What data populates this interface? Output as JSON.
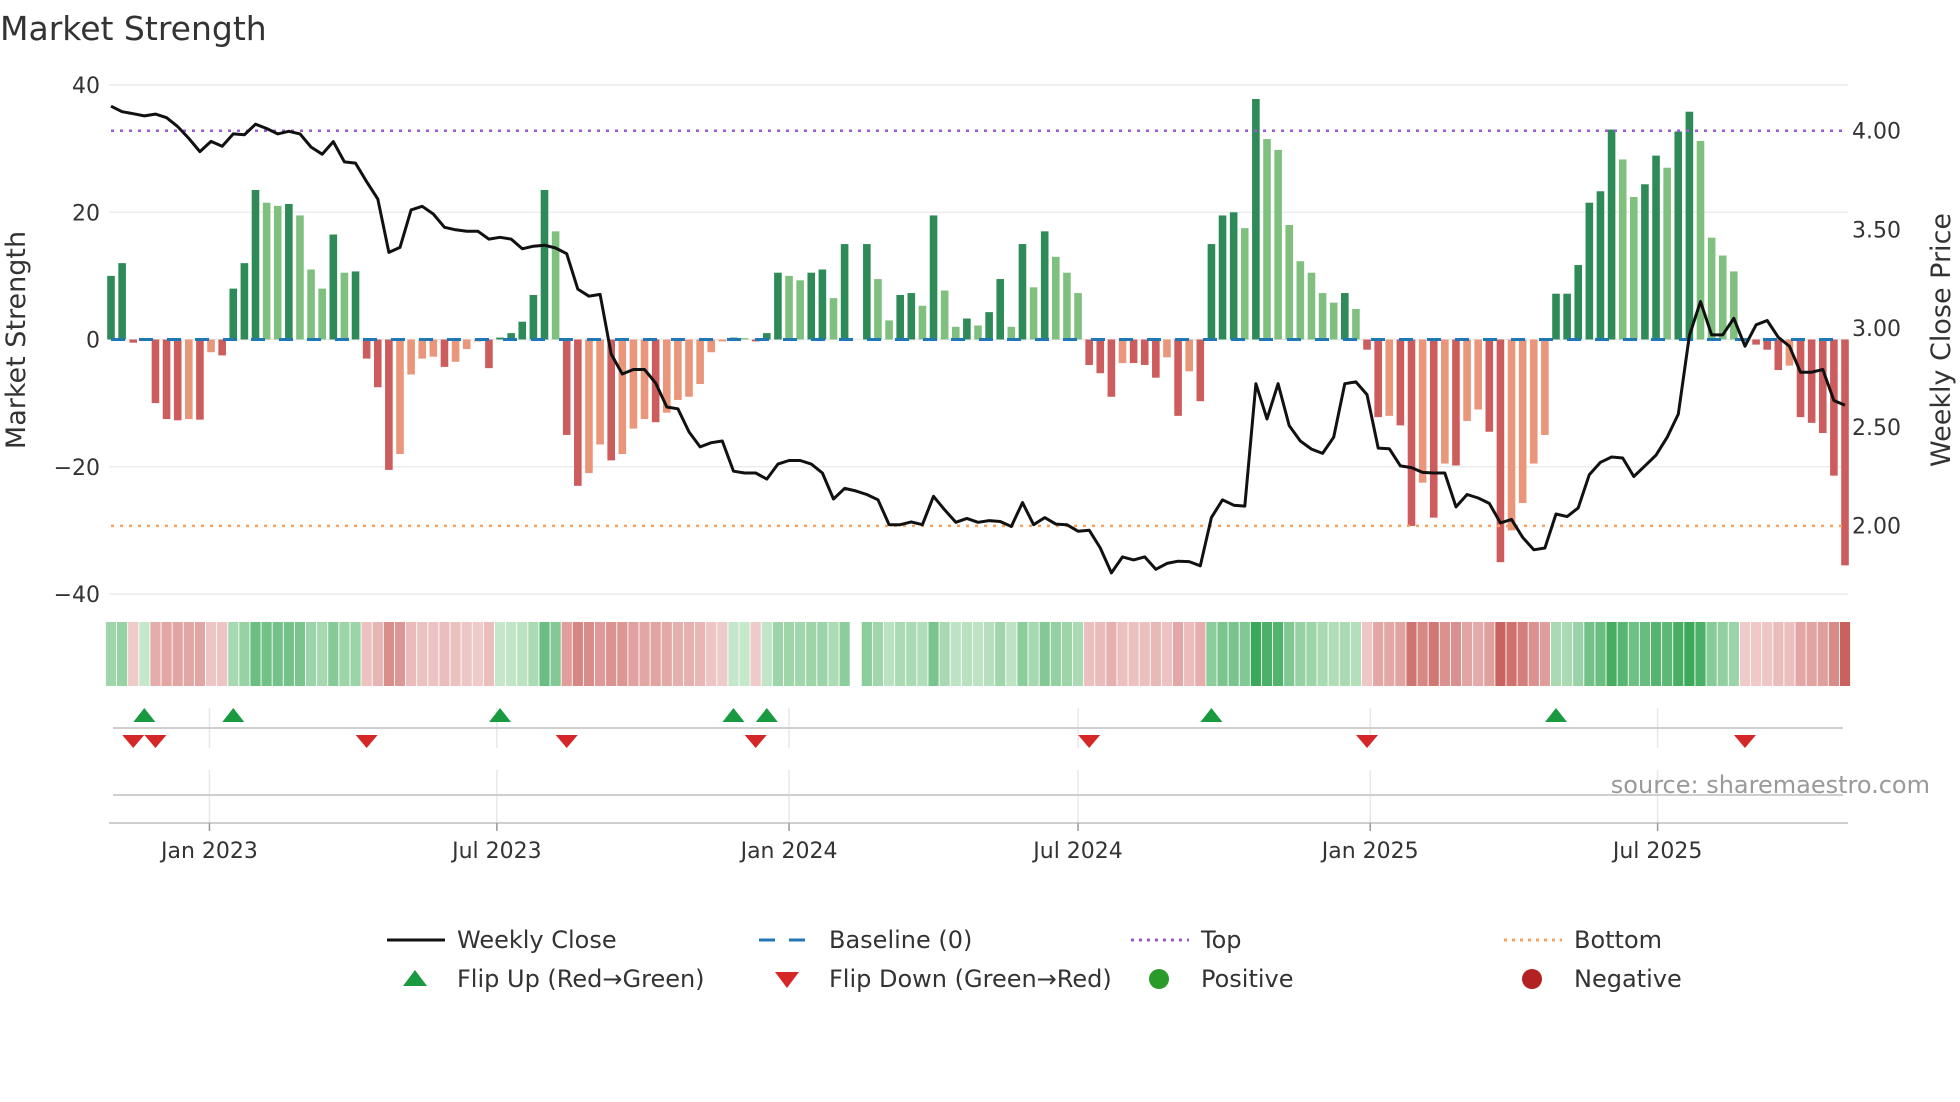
{
  "chart_data": {
    "type": "bar",
    "title": "Market Strength",
    "ylabel": "Market Strength",
    "y2label": "Weekly Close Price",
    "ylim": [
      -40,
      40
    ],
    "y2lim": [
      1.944,
      4.272
    ],
    "yticks": [
      "40",
      "20",
      "0",
      "−20",
      "−40"
    ],
    "ytick_values": [
      40,
      20,
      0,
      -20,
      -40
    ],
    "y2ticks": [
      "4.00",
      "3.50",
      "3.00",
      "2.50",
      "2.00"
    ],
    "y2tick_values": [
      4.0,
      3.5,
      3.0,
      2.5,
      2.0
    ],
    "start_date": "2022-10-31",
    "frequency": "weekly",
    "xticks": [
      {
        "label": "Jan 2023",
        "date": "2023-01-01"
      },
      {
        "label": "Jul 2023",
        "date": "2023-07-01"
      },
      {
        "label": "Jan 2024",
        "date": "2024-01-01"
      },
      {
        "label": "Jul 2024",
        "date": "2024-07-01"
      },
      {
        "label": "Jan 2025",
        "date": "2025-01-01"
      },
      {
        "label": "Jul 2025",
        "date": "2025-07-01"
      }
    ],
    "top_threshold": 32.8,
    "bottom_threshold": -29.3,
    "baseline": 0,
    "strength": [
      10,
      12,
      -0.5,
      0.2,
      -10,
      -12.5,
      -12.7,
      -12.5,
      -12.6,
      -2,
      -2.5,
      8,
      12,
      23.5,
      21.5,
      21,
      21.3,
      19.5,
      11,
      8,
      16.5,
      10.5,
      10.7,
      -3,
      -7.5,
      -20.5,
      -18,
      -5.5,
      -3,
      -2.7,
      -4.3,
      -3.5,
      -1.5,
      -0.3,
      -4.5,
      0.3,
      1,
      2.8,
      7,
      23.5,
      17,
      -15,
      -23,
      -21,
      -16.5,
      -19,
      -18,
      -14,
      -12.5,
      -13,
      -11.5,
      -9.5,
      -9,
      -7,
      -2,
      -0.3,
      0.3,
      0.2,
      -0.3,
      1,
      10.5,
      10,
      9.3,
      10.5,
      11,
      6.5,
      15,
      null,
      15,
      9.5,
      3,
      7,
      7.3,
      5.3,
      19.5,
      7.7,
      2,
      3.3,
      2.2,
      4.3,
      9.5,
      2,
      15,
      8.2,
      17,
      13,
      10.5,
      7.3,
      -4,
      -5.3,
      -9,
      -3.7,
      -3.7,
      -4,
      -6,
      -2.8,
      -12,
      -5,
      -9.7,
      15,
      19.5,
      20,
      17.5,
      37.8,
      31.5,
      29.8,
      18,
      12.3,
      10.5,
      7.3,
      5.8,
      7.3,
      4.8,
      -1.6,
      -12.2,
      -12,
      -13.5,
      -29.3,
      -22.5,
      -28,
      -19.5,
      -19.8,
      -12.8,
      -11,
      -14.5,
      -35,
      -30,
      -25.7,
      -19.5,
      -15,
      7.2,
      7.2,
      11.7,
      21.5,
      23.3,
      33,
      28.3,
      22.4,
      24.4,
      28.9,
      27,
      32.7,
      35.8,
      31.2,
      16,
      13.2,
      10.7,
      -0.3,
      -0.8,
      -1.6,
      -4.8,
      -4.1,
      -12.2,
      -13.1,
      -14.7,
      -21.4,
      -35.5
    ],
    "weekly_close": [
      4.123,
      4.095,
      4.085,
      4.074,
      4.083,
      4.065,
      4.02,
      3.96,
      3.893,
      3.945,
      3.92,
      3.983,
      3.978,
      4.032,
      4.01,
      3.983,
      3.996,
      3.983,
      3.916,
      3.88,
      3.944,
      3.841,
      3.835,
      3.74,
      3.653,
      3.383,
      3.408,
      3.598,
      3.616,
      3.577,
      3.51,
      3.497,
      3.49,
      3.49,
      3.45,
      3.459,
      3.45,
      3.401,
      3.414,
      3.419,
      3.405,
      3.376,
      3.197,
      3.161,
      3.17,
      2.868,
      2.767,
      2.79,
      2.79,
      2.721,
      2.6,
      2.591,
      2.474,
      2.398,
      2.419,
      2.428,
      2.275,
      2.266,
      2.266,
      2.235,
      2.311,
      2.329,
      2.329,
      2.311,
      2.266,
      2.134,
      2.188,
      2.175,
      2.157,
      2.13,
      2.004,
      2.004,
      2.018,
      2.004,
      2.148,
      2.079,
      2.016,
      2.036,
      2.016,
      2.025,
      2.02,
      1.995,
      2.116,
      2.004,
      2.04,
      2.007,
      2.004,
      1.971,
      1.976,
      1.886,
      1.76,
      1.841,
      1.826,
      1.841,
      1.778,
      1.808,
      1.819,
      1.817,
      1.796,
      2.04,
      2.13,
      2.103,
      2.098,
      2.718,
      2.54,
      2.718,
      2.506,
      2.428,
      2.387,
      2.365,
      2.447,
      2.718,
      2.727,
      2.663,
      2.392,
      2.389,
      2.302,
      2.293,
      2.269,
      2.266,
      2.266,
      2.094,
      2.157,
      2.139,
      2.112,
      2.013,
      2.031,
      1.94,
      1.877,
      1.886,
      2.058,
      2.045,
      2.089,
      2.257,
      2.32,
      2.347,
      2.342,
      2.248,
      2.302,
      2.356,
      2.447,
      2.564,
      2.962,
      3.134,
      2.965,
      2.965,
      3.049,
      2.908,
      3.016,
      3.038,
      2.953,
      2.908,
      2.776,
      2.776,
      2.79,
      2.633,
      2.609
    ],
    "flip_up_weeks": [
      3,
      11,
      35,
      56,
      59,
      99,
      130
    ],
    "flip_down_weeks": [
      2,
      4,
      23,
      41,
      58,
      88,
      113,
      147
    ],
    "legend": {
      "placement": "bottom",
      "entries": [
        {
          "label": "Weekly Close",
          "symbol": "line",
          "color": "#111111"
        },
        {
          "label": "Baseline (0)",
          "symbol": "dash",
          "color": "#1f77b4"
        },
        {
          "label": "Top",
          "symbol": "dot",
          "color": "#9b59d6"
        },
        {
          "label": "Bottom",
          "symbol": "dot",
          "color": "#f4a460"
        },
        {
          "label": "Flip Up (Red→Green)",
          "symbol": "triangle-up",
          "color": "#1a9a40"
        },
        {
          "label": "Flip Down (Green→Red)",
          "symbol": "triangle-down",
          "color": "#d62728"
        },
        {
          "label": "Positive",
          "symbol": "circle",
          "color": "#2a9a2a"
        },
        {
          "label": "Negative",
          "symbol": "circle",
          "color": "#b22222"
        }
      ]
    },
    "colors": {
      "pos_strong": "#2e8b57",
      "pos_weak": "#80c07e",
      "neg_strong": "#cd5c5c",
      "neg_weak": "#e9967a"
    }
  },
  "source": "source: sharemaestro.com"
}
